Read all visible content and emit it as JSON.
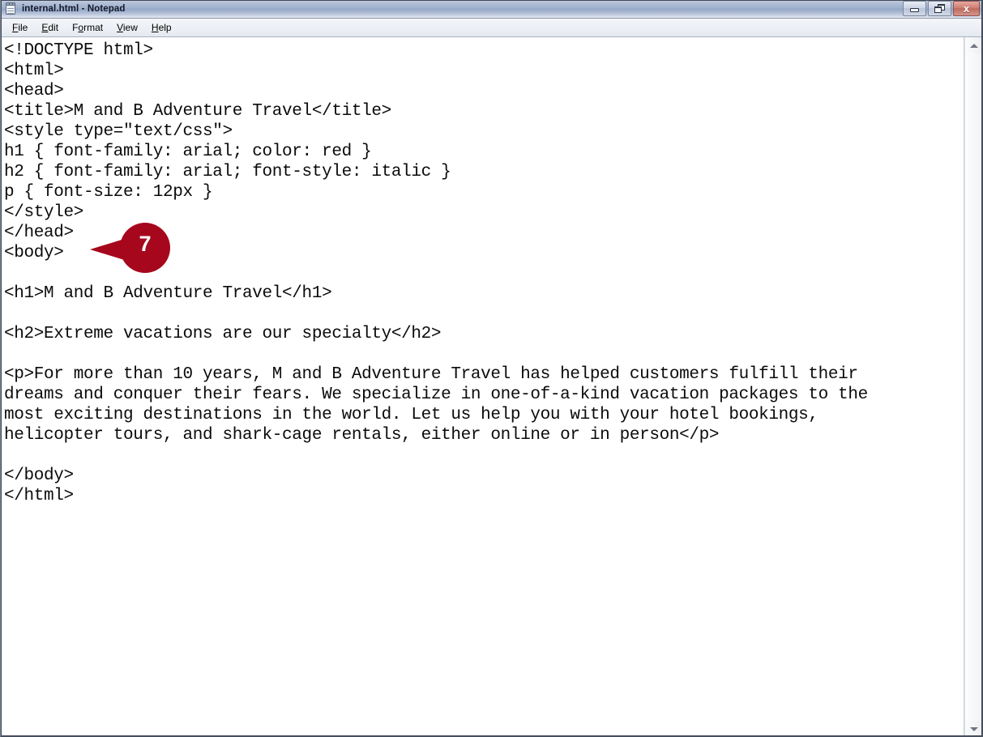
{
  "window": {
    "title": "internal.html - Notepad",
    "icon": "notepad-icon",
    "controls": {
      "minimize_label": "Minimize",
      "restore_label": "Restore",
      "close_label": "Close",
      "close_glyph": "x"
    }
  },
  "menubar": {
    "items": [
      {
        "label": "File",
        "accel": "F"
      },
      {
        "label": "Edit",
        "accel": "E"
      },
      {
        "label": "Format",
        "accel": "o"
      },
      {
        "label": "View",
        "accel": "V"
      },
      {
        "label": "Help",
        "accel": "H"
      }
    ]
  },
  "editor": {
    "content": "<!DOCTYPE html>\n<html>\n<head>\n<title>M and B Adventure Travel</title>\n<style type=\"text/css\">\nh1 { font-family: arial; color: red }\nh2 { font-family: arial; font-style: italic }\np { font-size: 12px }\n</style>\n</head>\n<body>\n\n<h1>M and B Adventure Travel</h1>\n\n<h2>Extreme vacations are our specialty</h2>\n\n<p>For more than 10 years, M and B Adventure Travel has helped customers fulfill their\ndreams and conquer their fears. We specialize in one-of-a-kind vacation packages to the\nmost exciting destinations in the world. Let us help you with your hotel bookings,\nhelicopter tours, and shark-cage rentals, either online or in person</p>\n\n</body>\n</html>"
  },
  "scrollbar": {
    "up_arrow": "scroll-up-arrow-icon",
    "down_arrow": "scroll-down-arrow-icon"
  },
  "annotation": {
    "number": "7",
    "color": "#A6071C",
    "points_at": "</style>"
  }
}
